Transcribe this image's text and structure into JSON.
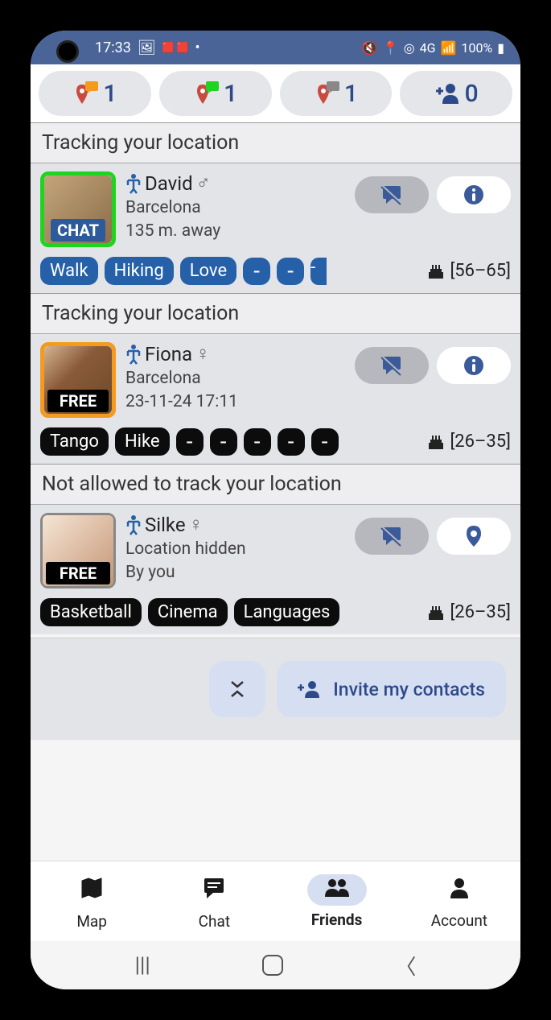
{
  "statusbar": {
    "time": "17:33",
    "battery": "100%",
    "network": "4G"
  },
  "top_badges": [
    {
      "count": "1",
      "speech_color": "#f49b1f"
    },
    {
      "count": "1",
      "speech_color": "#1fd421"
    },
    {
      "count": "1",
      "speech_color": "#888"
    },
    {
      "count": "0",
      "type": "add"
    }
  ],
  "sections": [
    {
      "header": "Tracking your location",
      "user": {
        "name": "David",
        "gender_symbol": "♂",
        "location": "Barcelona",
        "distance": "135 m. away",
        "avatar_border": "green",
        "avatar_badge": "CHAT",
        "tags": [
          "Walk",
          "Hiking",
          "Love"
        ],
        "tag_style": "blue",
        "extra_tags": 3,
        "age_range": "[56–65]",
        "right_icon": "info"
      }
    },
    {
      "header": "Tracking your location",
      "user": {
        "name": "Fiona",
        "gender_symbol": "♀",
        "location": "Barcelona",
        "distance": "23-11-24 17:11",
        "avatar_border": "orange",
        "avatar_badge": "FREE",
        "tags": [
          "Tango",
          "Hike"
        ],
        "tag_style": "black",
        "extra_tags": 5,
        "age_range": "[26–35]",
        "right_icon": "info"
      }
    },
    {
      "header": "Not allowed to track your location",
      "user": {
        "name": "Silke",
        "gender_symbol": "♀",
        "location": "Location hidden",
        "distance": "By you",
        "avatar_border": "gray",
        "avatar_badge": "FREE",
        "tags": [
          "Basketball",
          "Cinema",
          "Languages"
        ],
        "tag_style": "black",
        "extra_tags": 0,
        "age_range": "[26–35]",
        "right_icon": "pin"
      }
    }
  ],
  "invite": {
    "label": "Invite my contacts"
  },
  "bottom_nav": [
    {
      "label": "Map",
      "icon": "map"
    },
    {
      "label": "Chat",
      "icon": "chat"
    },
    {
      "label": "Friends",
      "icon": "friends",
      "active": true
    },
    {
      "label": "Account",
      "icon": "account"
    }
  ]
}
